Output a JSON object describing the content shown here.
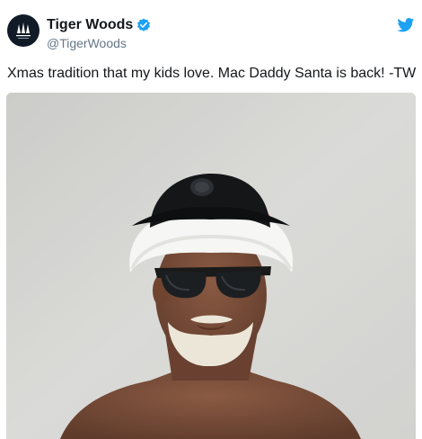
{
  "tweet": {
    "display_name": "Tiger Woods",
    "handle": "@TigerWoods",
    "text": "Xmas tradition that my kids love. Mac Daddy Santa is back! -TW",
    "verified": true,
    "avatar_logo_text": "TGR",
    "icons": {
      "verified": "verified-badge-icon",
      "platform": "twitter-bird-icon"
    }
  },
  "colors": {
    "brand_blue": "#1da1f2",
    "text_primary": "#14171a",
    "text_secondary": "#657786",
    "avatar_bg": "#111a27"
  }
}
